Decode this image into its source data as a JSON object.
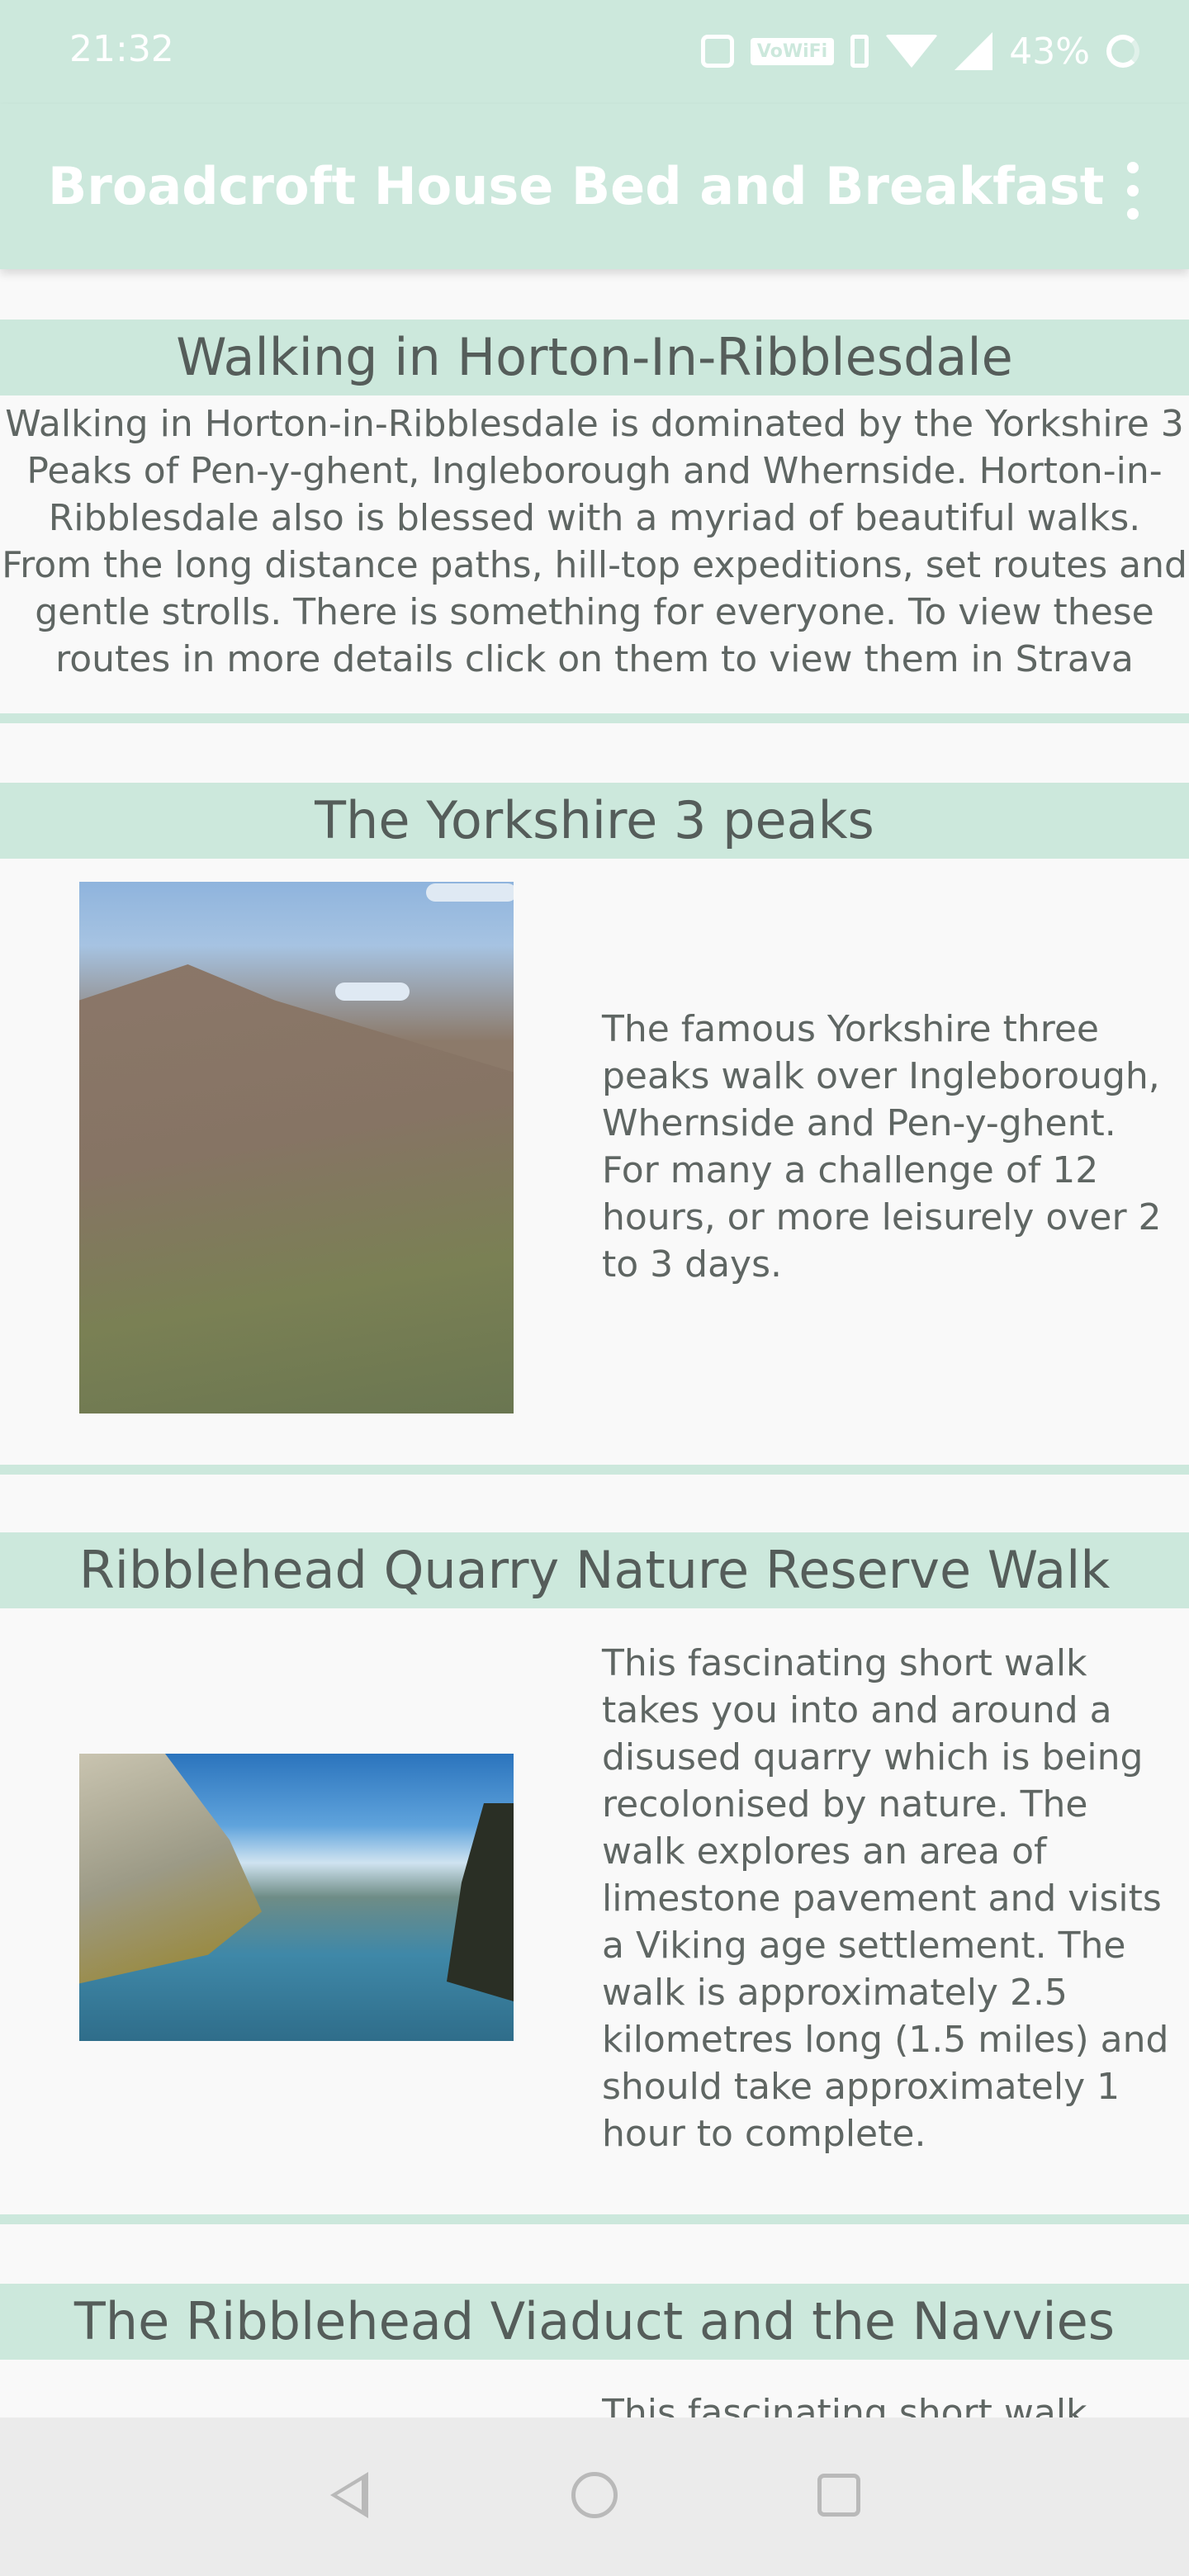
{
  "status_bar": {
    "time": "21:32",
    "vowifi_label": "VoWiFi",
    "battery": "43%",
    "icons": [
      "nfc-icon",
      "vowifi-icon",
      "vibrate-icon",
      "wifi-icon",
      "signal-icon",
      "battery-ring-icon"
    ]
  },
  "app_bar": {
    "title": "Broadcroft House Bed and Breakfast",
    "menu_icon": "overflow-menu-icon"
  },
  "intro": {
    "heading": "Walking in Horton-In-Ribblesdale",
    "body": "Walking in Horton-in-Ribblesdale is dominated by the Yorkshire 3 Peaks of Pen-y-ghent, Ingleborough and Whernside. Horton-in-Ribblesdale also is blessed with a myriad of beautiful walks. From the long distance paths, hill-top expeditions, set routes and gentle strolls. There is something for everyone. To view these routes in more details click on them to view them in Strava"
  },
  "walks": [
    {
      "title": "The Yorkshire 3 peaks",
      "description": "The famous Yorkshire three peaks walk over Ingleborough, Whernside and Pen-y-ghent. For many a challenge of 12 hours, or more leisurely over 2 to 3 days."
    },
    {
      "title": "Ribblehead Quarry Nature Reserve Walk",
      "description": "This fascinating short walk takes you into and around a disused quarry which is being recolonised by nature. The walk explores an area of limestone pavement and visits a Viking age settlement. The walk is approximately 2.5 kilometres long (1.5 miles) and should take approximately 1 hour to complete."
    },
    {
      "title": "The Ribblehead Viaduct and the Navvies",
      "description": "This fascinating short walk"
    }
  ],
  "nav_bar": {
    "icons": [
      "back-icon",
      "home-icon",
      "recents-icon"
    ]
  },
  "colors": {
    "accent": "#cce8dc",
    "text": "#5f6663",
    "background": "#f9f9f9"
  }
}
